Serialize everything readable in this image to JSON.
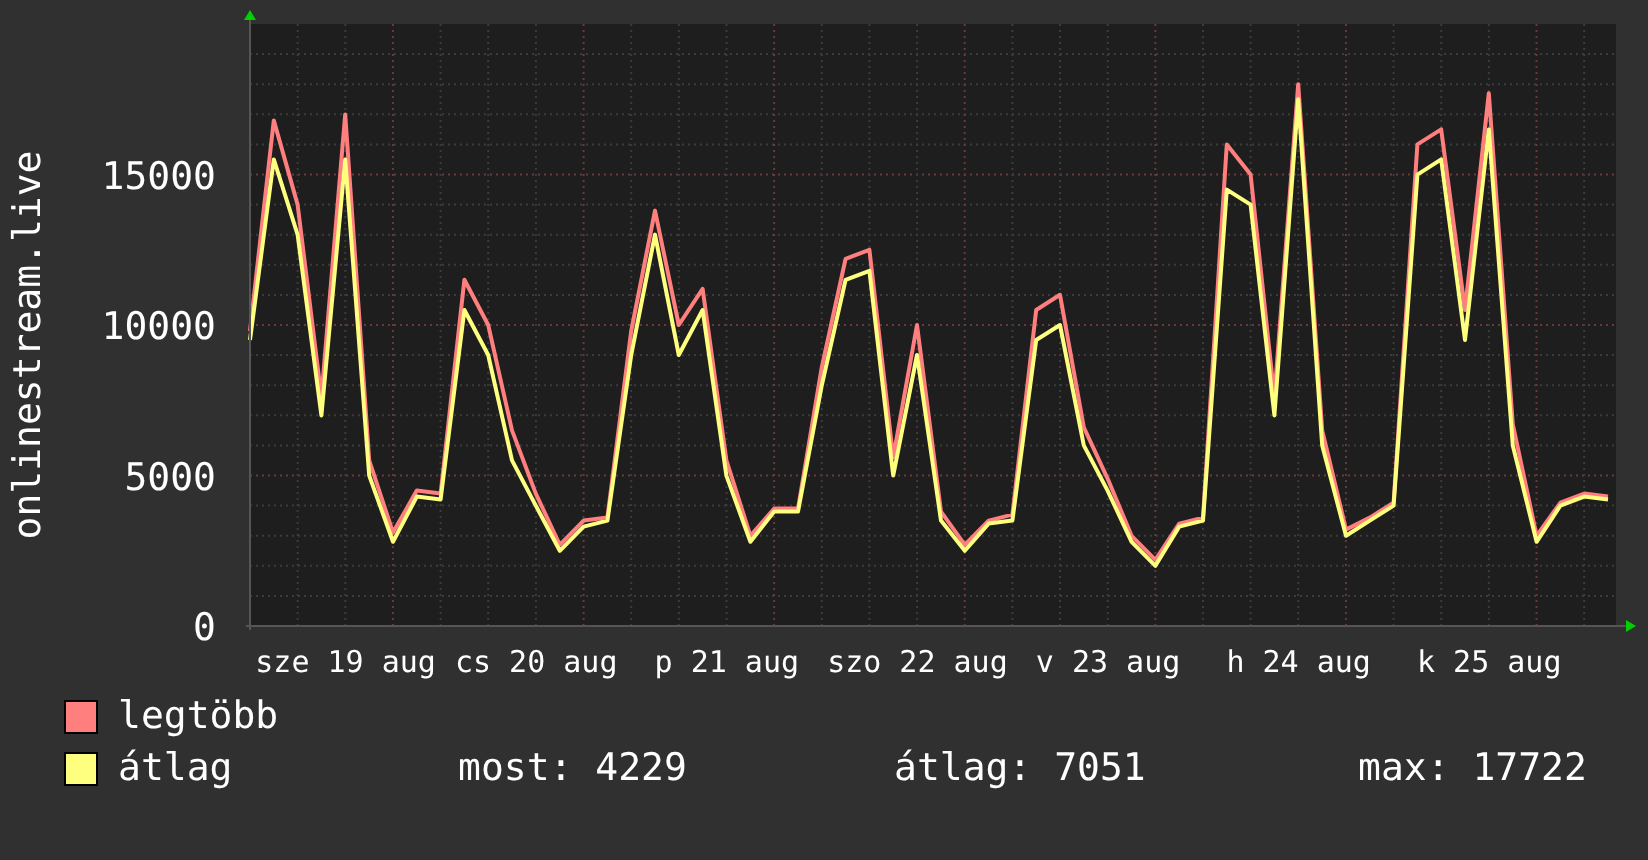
{
  "chart": {
    "x_labels": [
      "sze 19 aug",
      "cs 20 aug",
      "p 21 aug",
      "szo 22 aug",
      "v 23 aug",
      "h 24 aug",
      "k 25 aug"
    ],
    "chart_data": {
      "type": "line",
      "grid": true,
      "ylabel": "onlinestream.live",
      "ylim": [
        0,
        20000
      ],
      "yticks": [
        0,
        5000,
        10000,
        15000
      ],
      "series": [
        {
          "name": "legtöbb",
          "color": "#ff7f7f",
          "values": [
            9800,
            16800,
            14000,
            7600,
            17000,
            5500,
            3100,
            4500,
            4400,
            11500,
            10000,
            6500,
            4400,
            2700,
            3500,
            3600,
            9800,
            13800,
            10000,
            11200,
            5500,
            3000,
            3900,
            3900,
            8600,
            12200,
            12500,
            5600,
            10000,
            3800,
            2700,
            3500,
            3700,
            10500,
            11000,
            6600,
            4900,
            3000,
            2200,
            3400,
            3600,
            16000,
            15000,
            7600,
            18000,
            6500,
            3200,
            3600,
            4100,
            16000,
            16500,
            10500,
            17700,
            6700,
            3000,
            4100,
            4400,
            4300
          ]
        },
        {
          "name": "átlag",
          "color": "#ffff7f",
          "values": [
            9500,
            15500,
            13000,
            7000,
            15500,
            5000,
            2800,
            4300,
            4200,
            10500,
            9000,
            5500,
            4000,
            2500,
            3300,
            3500,
            9000,
            13000,
            9000,
            10500,
            5000,
            2800,
            3800,
            3800,
            8000,
            11500,
            11800,
            5000,
            9000,
            3500,
            2500,
            3400,
            3500,
            9500,
            10000,
            6000,
            4500,
            2800,
            2000,
            3300,
            3500,
            14500,
            14000,
            7000,
            17500,
            6000,
            3000,
            3500,
            4000,
            15000,
            15500,
            9500,
            16500,
            6000,
            2800,
            4000,
            4300,
            4200
          ]
        }
      ]
    }
  },
  "legend": {
    "stats": [
      "most: 4229",
      "átlag: 7051",
      "max: 17722"
    ]
  }
}
